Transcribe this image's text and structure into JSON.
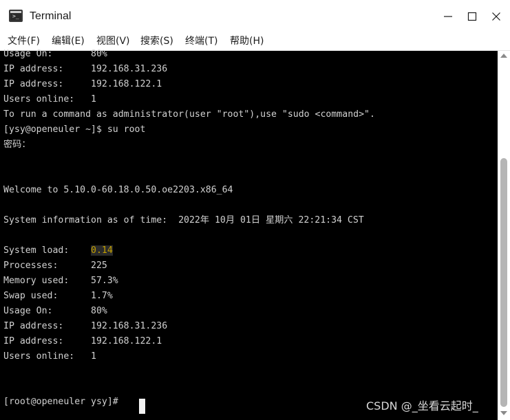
{
  "window": {
    "title": "Terminal",
    "icon": "terminal-icon"
  },
  "menu": [
    {
      "id": "file",
      "label": "文件(F)"
    },
    {
      "id": "edit",
      "label": "编辑(E)"
    },
    {
      "id": "view",
      "label": "视图(V)"
    },
    {
      "id": "search",
      "label": "搜索(S)"
    },
    {
      "id": "terminal",
      "label": "终端(T)"
    },
    {
      "id": "help",
      "label": "帮助(H)"
    }
  ],
  "terminal": {
    "lines": [
      "Usage On:       80%",
      "IP address:     192.168.31.236",
      "IP address:     192.168.122.1",
      "Users online:   1",
      "To run a command as administrator(user \"root\"),use \"sudo <command>\".",
      "[ysy@openeuler ~]$ su root",
      "密码：",
      "",
      "",
      "Welcome to 5.10.0-60.18.0.50.oe2203.x86_64",
      "",
      "System information as of time:  2022年 10月 01日 星期六 22:21:34 CST",
      "",
      "System load:    ",
      "Processes:      225",
      "Memory used:    57.3%",
      "Swap used:      1.7%",
      "Usage On:       80%",
      "IP address:     192.168.31.236",
      "IP address:     192.168.122.1",
      "Users online:   1",
      "",
      "",
      "[root@openeuler ysy]# "
    ],
    "system_load_value": "0.14"
  },
  "watermark": "CSDN @_坐看云起时_",
  "colors": {
    "terminal_bg": "#000000",
    "terminal_fg": "#d2d2d2",
    "highlight_fg": "#c4a000"
  }
}
